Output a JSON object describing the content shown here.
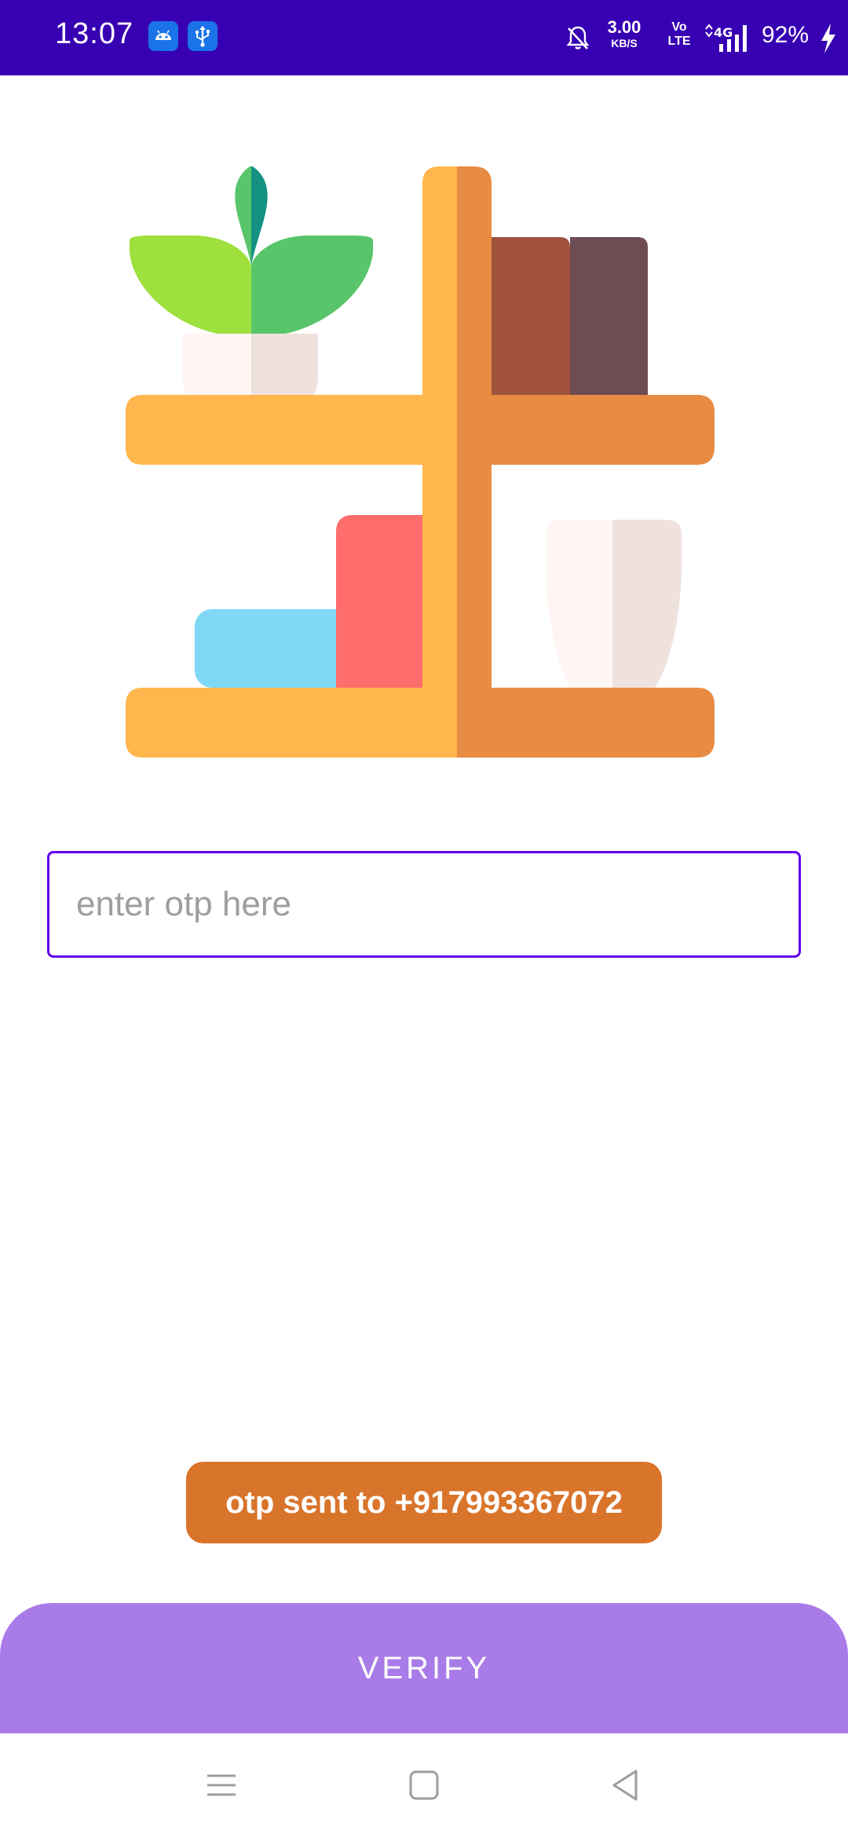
{
  "status_bar": {
    "time": "13:07",
    "net_speed_value": "3.00",
    "net_speed_unit": "KB/S",
    "volte_top": "Vo",
    "volte_bottom": "LTE",
    "network_type": "4G",
    "battery_percent": "92%",
    "icons": [
      "android-notification-icon",
      "usb-notification-icon",
      "bell-off-icon",
      "signal-icon",
      "charging-icon"
    ],
    "background_color": "#3700b3"
  },
  "illustration": {
    "name": "bookshelf-illustration",
    "colors": {
      "shelf_light": "#ffb64d",
      "shelf_dark": "#e88b43",
      "book_brown": "#a0523f",
      "book_plum": "#6d4c52",
      "box_blue": "#7fd8f6",
      "box_red": "#ff6d6d",
      "leaf_lime": "#9ee03e",
      "leaf_green": "#58c56b",
      "leaf_teal": "#139283",
      "pot_light": "#fff5f3",
      "pot_shade": "#efe2dd"
    }
  },
  "otp_form": {
    "value": "",
    "placeholder": "enter otp here",
    "border_color": "#6200ee"
  },
  "toast": {
    "message": "otp sent to +917993367072",
    "background_color": "#d9742b"
  },
  "verify_button": {
    "label": "VERIFY",
    "background_color": "#a97be8"
  },
  "nav_bar": {
    "buttons": [
      "menu-icon",
      "home-icon",
      "back-icon"
    ]
  }
}
